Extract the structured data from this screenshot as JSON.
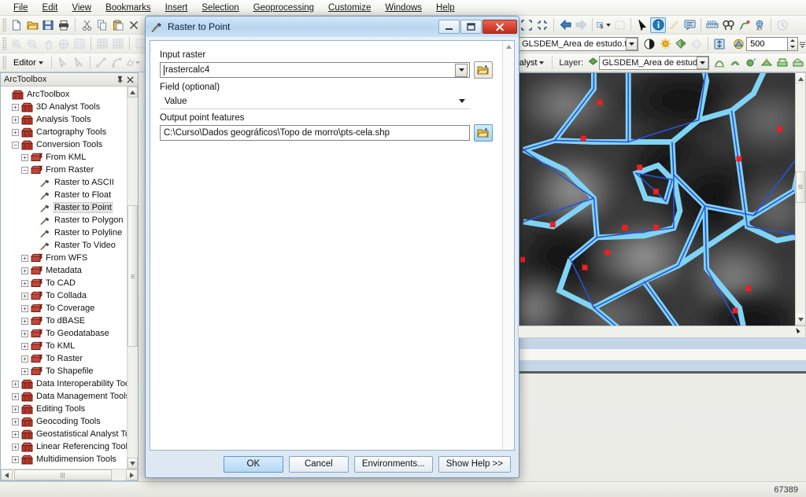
{
  "app": {
    "menu": [
      {
        "label": "File",
        "accel": "F"
      },
      {
        "label": "Edit",
        "accel": "E"
      },
      {
        "label": "View",
        "accel": "V"
      },
      {
        "label": "Bookmarks",
        "accel": "B"
      },
      {
        "label": "Insert",
        "accel": "I"
      },
      {
        "label": "Selection",
        "accel": "S"
      },
      {
        "label": "Geoprocessing",
        "accel": "G"
      },
      {
        "label": "Customize",
        "accel": "C"
      },
      {
        "label": "Windows",
        "accel": "W"
      },
      {
        "label": "Help",
        "accel": "H"
      }
    ]
  },
  "toolbars": {
    "standard_icons": [
      "new-document-icon",
      "open-folder-icon",
      "save-icon",
      "print-icon",
      "cut-icon",
      "copy-icon",
      "paste-icon",
      "delete-icon"
    ],
    "navigation_icons": [
      "zoom-in-icon",
      "zoom-out-icon",
      "pan-icon",
      "full-extent-icon",
      "fixed-zoom-icon",
      "previous-extent-icon",
      "next-extent-icon",
      "select-features-icon"
    ],
    "map_tools": [
      "zoom-in-icon",
      "zoom-out-icon",
      "pan-icon",
      "full-extent-icon",
      "back-extent-icon",
      "forward-extent-icon",
      "select-elements-icon",
      "identify-icon",
      "hyperlink-icon",
      "html-popup-icon",
      "measure-icon",
      "find-icon",
      "find-route-icon",
      "go-to-xy-icon",
      "time-slider-icon"
    ],
    "editor": {
      "label": "Editor",
      "icons": [
        "edit-tool-icon",
        "edit-annotation-icon",
        "straight-segment-icon",
        "arc-segment-icon",
        "trace-icon"
      ]
    },
    "effects": {
      "layer_value": "GLSDEM_Area de estudo.tif",
      "icons": [
        "contrast-icon",
        "brightness-icon",
        "transparency-icon",
        "swipe-icon",
        "flicker-icon",
        "swipe-layer-icon"
      ],
      "flicker_value": "500"
    },
    "spatial_analyst": {
      "menu_label": "Analyst",
      "layer_label": "Layer:",
      "layer_value": "GLSDEM_Area de estudo.tif",
      "icons": [
        "histogram-icon",
        "contour-icon",
        "raster-calculator-icon",
        "interpolate-icon",
        "surface-icon",
        "reclassify-icon"
      ]
    }
  },
  "toolbox": {
    "title": "ArcToolbox",
    "pin_icon": "pin-icon",
    "close_icon": "close-icon",
    "tree": [
      {
        "label": "ArcToolbox",
        "depth": 0,
        "state": "root",
        "icon": "toolbox-icon"
      },
      {
        "label": "3D Analyst Tools",
        "depth": 1,
        "state": "collapsed",
        "icon": "toolbox-icon"
      },
      {
        "label": "Analysis Tools",
        "depth": 1,
        "state": "collapsed",
        "icon": "toolbox-icon"
      },
      {
        "label": "Cartography Tools",
        "depth": 1,
        "state": "collapsed",
        "icon": "toolbox-icon"
      },
      {
        "label": "Conversion Tools",
        "depth": 1,
        "state": "expanded",
        "icon": "toolbox-icon"
      },
      {
        "label": "From KML",
        "depth": 2,
        "state": "collapsed",
        "icon": "toolset-icon"
      },
      {
        "label": "From Raster",
        "depth": 2,
        "state": "expanded",
        "icon": "toolset-icon"
      },
      {
        "label": "Raster to ASCII",
        "depth": 3,
        "state": "leaf",
        "icon": "tool-icon"
      },
      {
        "label": "Raster to Float",
        "depth": 3,
        "state": "leaf",
        "icon": "tool-icon"
      },
      {
        "label": "Raster to Point",
        "depth": 3,
        "state": "leaf",
        "icon": "tool-icon",
        "selected": true
      },
      {
        "label": "Raster to Polygon",
        "depth": 3,
        "state": "leaf",
        "icon": "tool-icon"
      },
      {
        "label": "Raster to Polyline",
        "depth": 3,
        "state": "leaf",
        "icon": "tool-icon"
      },
      {
        "label": "Raster To Video",
        "depth": 3,
        "state": "leaf",
        "icon": "tool-icon"
      },
      {
        "label": "From WFS",
        "depth": 2,
        "state": "collapsed",
        "icon": "toolset-icon"
      },
      {
        "label": "Metadata",
        "depth": 2,
        "state": "collapsed",
        "icon": "toolset-icon"
      },
      {
        "label": "To CAD",
        "depth": 2,
        "state": "collapsed",
        "icon": "toolset-icon"
      },
      {
        "label": "To Collada",
        "depth": 2,
        "state": "collapsed",
        "icon": "toolset-icon"
      },
      {
        "label": "To Coverage",
        "depth": 2,
        "state": "collapsed",
        "icon": "toolset-icon"
      },
      {
        "label": "To dBASE",
        "depth": 2,
        "state": "collapsed",
        "icon": "toolset-icon"
      },
      {
        "label": "To Geodatabase",
        "depth": 2,
        "state": "collapsed",
        "icon": "toolset-icon"
      },
      {
        "label": "To KML",
        "depth": 2,
        "state": "collapsed",
        "icon": "toolset-icon"
      },
      {
        "label": "To Raster",
        "depth": 2,
        "state": "collapsed",
        "icon": "toolset-icon"
      },
      {
        "label": "To Shapefile",
        "depth": 2,
        "state": "collapsed",
        "icon": "toolset-icon"
      },
      {
        "label": "Data Interoperability Tools",
        "depth": 1,
        "state": "collapsed",
        "icon": "toolbox-icon"
      },
      {
        "label": "Data Management Tools",
        "depth": 1,
        "state": "collapsed",
        "icon": "toolbox-icon"
      },
      {
        "label": "Editing Tools",
        "depth": 1,
        "state": "collapsed",
        "icon": "toolbox-icon"
      },
      {
        "label": "Geocoding Tools",
        "depth": 1,
        "state": "collapsed",
        "icon": "toolbox-icon"
      },
      {
        "label": "Geostatistical Analyst Tool",
        "depth": 1,
        "state": "collapsed",
        "icon": "toolbox-icon"
      },
      {
        "label": "Linear Referencing Tools",
        "depth": 1,
        "state": "collapsed",
        "icon": "toolbox-icon"
      },
      {
        "label": "Multidimension Tools",
        "depth": 1,
        "state": "collapsed",
        "icon": "toolbox-icon"
      }
    ]
  },
  "dialog": {
    "title": "Raster to Point",
    "title_icon": "tool-icon",
    "minimize_icon": "minimize-icon",
    "maximize_icon": "maximize-icon",
    "close_icon": "close-icon",
    "fields": {
      "input_raster_label": "Input raster",
      "input_raster_value": "rastercalc4",
      "field_label": "Field (optional)",
      "field_value": "Value",
      "output_label": "Output point features",
      "output_value": "C:\\Curso\\Dados geográficos\\Topo de morro\\pts-cela.shp",
      "browse_icon": "browse-folder-icon",
      "dropdown_icon": "chevron-down-icon"
    },
    "buttons": {
      "ok": "OK",
      "cancel": "Cancel",
      "environments": "Environments...",
      "show_help": "Show Help >>"
    }
  },
  "statusbar": {
    "coordinates": "67389"
  },
  "colors": {
    "accent": "#b9d5ef",
    "close_red": "#c1291a",
    "map_line": "#6ec8f0",
    "map_point": "#ee2020",
    "dialog_border": "#6f96bd"
  }
}
